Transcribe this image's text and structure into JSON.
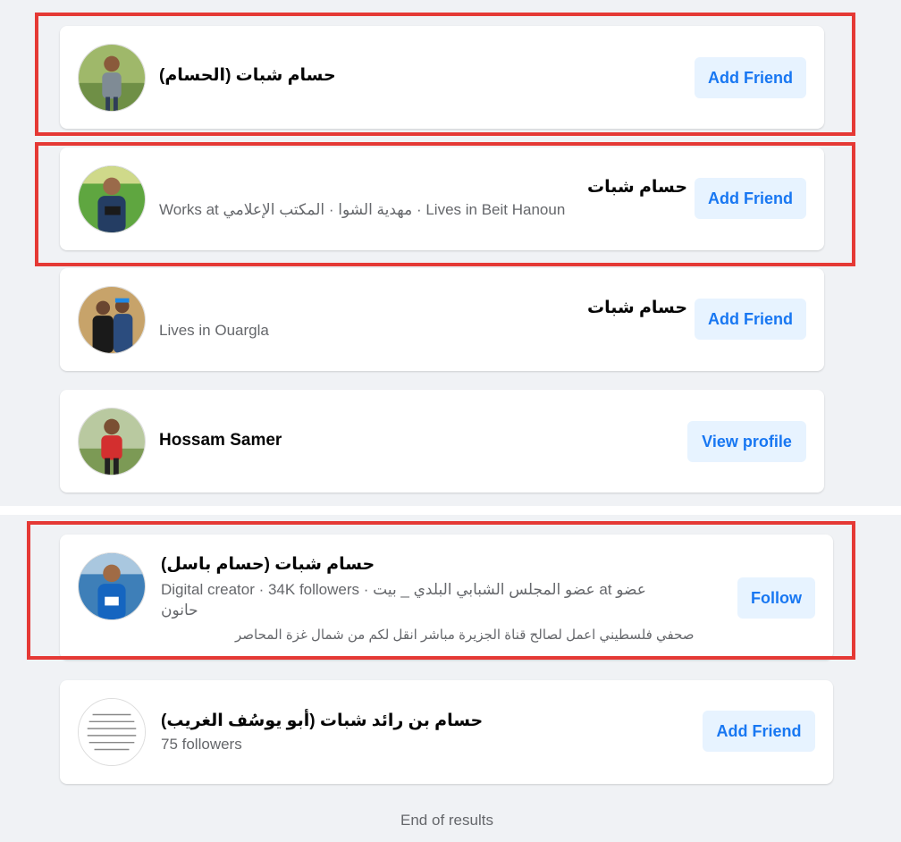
{
  "colors": {
    "page_bg": "#f0f2f5",
    "card_bg": "#ffffff",
    "button_bg": "#e7f3ff",
    "button_text": "#1877f2",
    "name_text": "#050505",
    "secondary_text": "#65676b",
    "highlight_border": "#e53935"
  },
  "results": [
    {
      "name": "(الحسام) حسام شبات",
      "subtitle": "",
      "bio": "",
      "action": "Add Friend",
      "avatar_icon": "person-photo-icon",
      "highlighted": true
    },
    {
      "name": "حسام شبات",
      "subtitle": "Works at مهدية الشوا · المكتب الإعلامي · Lives in Beit Hanoun",
      "bio": "",
      "action": "Add Friend",
      "avatar_icon": "person-photo-icon",
      "highlighted": true
    },
    {
      "name": "حسام شبات",
      "subtitle": "Lives in Ouargla",
      "bio": "",
      "action": "Add Friend",
      "avatar_icon": "people-photo-icon",
      "highlighted": false
    },
    {
      "name": "Hossam Samer",
      "subtitle": "",
      "bio": "",
      "action": "View profile",
      "avatar_icon": "person-photo-icon",
      "highlighted": false
    },
    {
      "name": "(حسام باسل) حسام شبات",
      "subtitle_line1": "Digital creator · 34K followers · عضو المجلس الشبابي البلدي _ بيت at عضو",
      "subtitle_line2": "حانون",
      "bio": "صحفي فلسطيني اعمل لصالح قناة الجزيرة مباشر انقل لكم من شمال غزة المحاصر",
      "action": "Follow",
      "avatar_icon": "person-photo-icon",
      "highlighted": true
    },
    {
      "name": "(أبو يوسُف الغريب) حسام بن رائد شبات",
      "subtitle": "75 followers",
      "bio": "",
      "action": "Add Friend",
      "avatar_icon": "text-image-icon",
      "highlighted": false
    }
  ],
  "footer": {
    "end_text": "End of results"
  }
}
